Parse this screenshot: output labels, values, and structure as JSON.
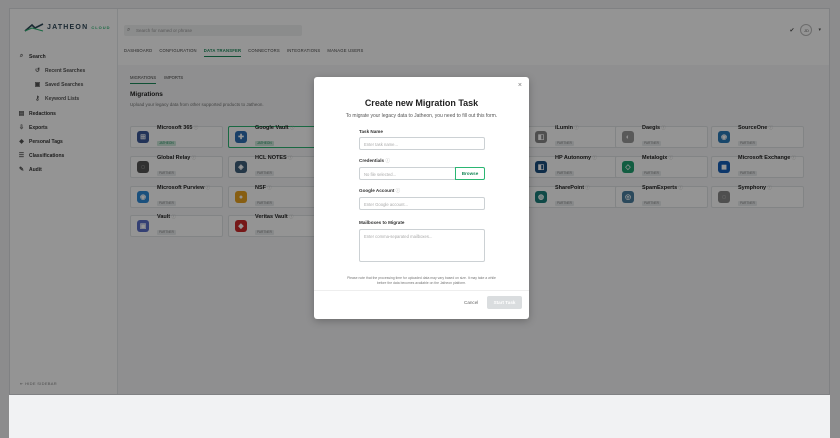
{
  "app": {
    "logo_text": "JATHEON",
    "logo_tag": "CLOUD",
    "avatar": "JD"
  },
  "search": {
    "placeholder": "Search for named or phrase"
  },
  "top_tabs": [
    "DASHBOARD",
    "CONFIGURATION",
    "DATA TRANSFER",
    "CONNECTORS",
    "INTEGRATIONS",
    "MANAGE USERS"
  ],
  "sidebar": {
    "items": [
      {
        "label": "Search",
        "icon": "search-icon"
      },
      {
        "label": "Recent Searches",
        "icon": "history-icon"
      },
      {
        "label": "Saved Searches",
        "icon": "save-icon"
      },
      {
        "label": "Keyword Lists",
        "icon": "key-icon"
      },
      {
        "label": "Redactions",
        "icon": "redaction-icon"
      },
      {
        "label": "Exports",
        "icon": "export-icon"
      },
      {
        "label": "Personal Tags",
        "icon": "tag-icon"
      },
      {
        "label": "Classifications",
        "icon": "classification-icon"
      },
      {
        "label": "Audit",
        "icon": "audit-icon"
      }
    ],
    "hide_label": "HIDE SIDEBAR"
  },
  "sub_tabs": [
    "MIGRATIONS",
    "IMPORTS"
  ],
  "section": {
    "title": "Migrations",
    "description": "Upload your legacy data from other supported products to Jatheon."
  },
  "sources": [
    {
      "name": "Microsoft 365",
      "badge": "JATHEON",
      "color": "#3b5998"
    },
    {
      "name": "Google Vault",
      "badge": "JATHEON",
      "color": "#2e6fb4"
    },
    {
      "name": "iLumin",
      "badge": "PARTNER",
      "color": "#888888"
    },
    {
      "name": "Daegis",
      "badge": "PARTNER",
      "color": "#999999"
    },
    {
      "name": "SourceOne",
      "badge": "PARTNER",
      "color": "#2a7ab8"
    },
    {
      "name": "Global Relay",
      "badge": "PARTNER",
      "color": "#555555"
    },
    {
      "name": "HCL NOTES",
      "badge": "PARTNER",
      "color": "#3f5f7a"
    },
    {
      "name": "HP Autonomy",
      "badge": "PARTNER",
      "color": "#1a4f7f"
    },
    {
      "name": "Metalogix",
      "badge": "PARTNER",
      "color": "#20a070"
    },
    {
      "name": "Microsoft Exchange",
      "badge": "PARTNER",
      "color": "#1560b8"
    },
    {
      "name": "Microsoft Purview",
      "badge": "PARTNER",
      "color": "#2e8ad8"
    },
    {
      "name": "NSF",
      "badge": "PARTNER",
      "color": "#e8a320"
    },
    {
      "name": "SharePoint",
      "badge": "PARTNER",
      "color": "#1b7f7a"
    },
    {
      "name": "SpamExperts",
      "badge": "PARTNER",
      "color": "#4a7f9f"
    },
    {
      "name": "Symphony",
      "badge": "PARTNER",
      "color": "#888888"
    },
    {
      "name": "Vault",
      "badge": "PARTNER",
      "color": "#5a6fc8"
    },
    {
      "name": "Veritas Vault",
      "badge": "PARTNER",
      "color": "#cc2a2a"
    }
  ],
  "modal": {
    "title": "Create new Migration Task",
    "subtitle": "To migrate your legacy data to Jatheon, you need to fill out this form.",
    "task_name_label": "Task Name",
    "task_name_placeholder": "Enter task name...",
    "credentials_label": "Credentials",
    "credentials_placeholder": "No file selected...",
    "browse_label": "Browse",
    "google_account_label": "Google Account",
    "google_account_placeholder": "Enter Google account...",
    "mailboxes_label": "Mailboxes to Migrate",
    "mailboxes_placeholder": "Enter comma-separated mailboxes...",
    "note_line1": "Please note that the processing time for uploaded data may vary based on size. It may take a while",
    "note_line2": "before the data becomes available on the Jatheon platform.",
    "cancel_label": "Cancel",
    "start_label": "Start Task"
  }
}
